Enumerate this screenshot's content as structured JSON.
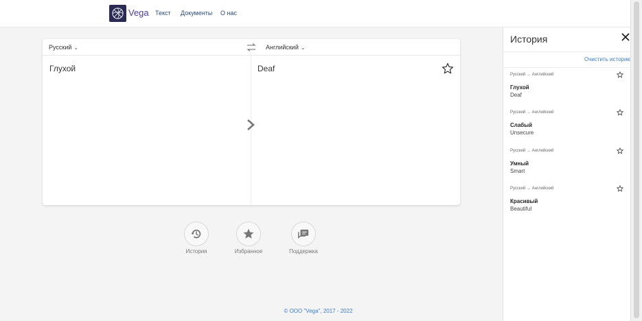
{
  "header": {
    "brand": "Vega",
    "nav": [
      "Текст",
      "Документы",
      "О нас"
    ]
  },
  "translator": {
    "source_lang": "Русский",
    "target_lang": "Английский",
    "source_text": "Глухой",
    "target_text": "Deaf"
  },
  "actions": [
    {
      "label": "История",
      "icon": "history-icon"
    },
    {
      "label": "Избранное",
      "icon": "star-icon"
    },
    {
      "label": "Поддержка",
      "icon": "support-icon"
    }
  ],
  "footer": "© ООО \"Vega\", 2017 - 2022",
  "history_panel": {
    "title": "История",
    "clear_label": "Очистить историю",
    "items": [
      {
        "direction": "Русский → Английский",
        "source": "Глухой",
        "target": "Deaf"
      },
      {
        "direction": "Русский → Английский",
        "source": "Слабый",
        "target": "Unsecure"
      },
      {
        "direction": "Русский → Английский",
        "source": "Умный",
        "target": "Smart"
      },
      {
        "direction": "Русский → Английский",
        "source": "Красивый",
        "target": "Beautiful"
      }
    ]
  },
  "colors": {
    "accent": "#3a7bc8",
    "brand": "#2a2a55",
    "nav": "#2b4a7a"
  }
}
